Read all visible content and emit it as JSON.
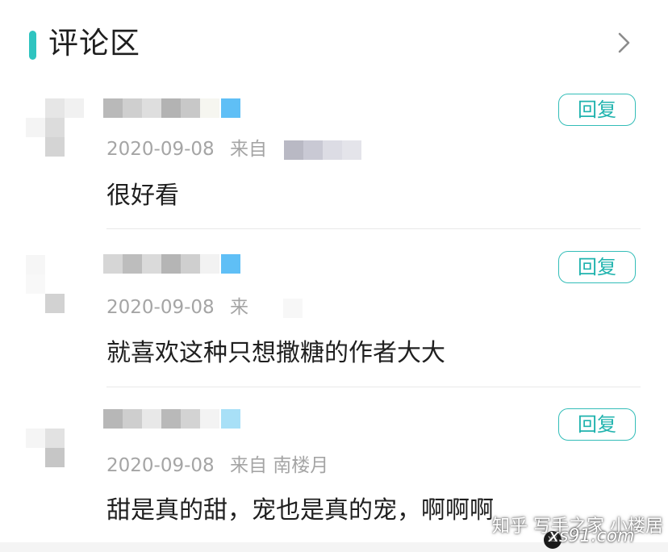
{
  "header": {
    "title": "评论区",
    "accent_color": "#2fc4c0",
    "more_icon": "chevron-right-icon"
  },
  "comments": [
    {
      "date": "2020-09-08",
      "source": "来自",
      "text": "很好看",
      "reply_label": "回复"
    },
    {
      "date": "2020-09-08",
      "source": "来",
      "text": "就喜欢这种只想撒糖的作者大大",
      "reply_label": "回复"
    },
    {
      "date": "2020-09-08",
      "source": "来自 南楼月",
      "text": "甜是真的甜，宠也是真的宠，啊啊啊",
      "reply_label": "回复"
    }
  ],
  "watermark": {
    "line1": "知乎 写手之家 小楼居",
    "badge": "XS",
    "site": "xs91.com"
  },
  "colors": {
    "reply_border": "#33bdb8",
    "reply_text": "#20b3ae",
    "meta_text": "#a5a5a5",
    "name_tag": "#5bbef5"
  }
}
